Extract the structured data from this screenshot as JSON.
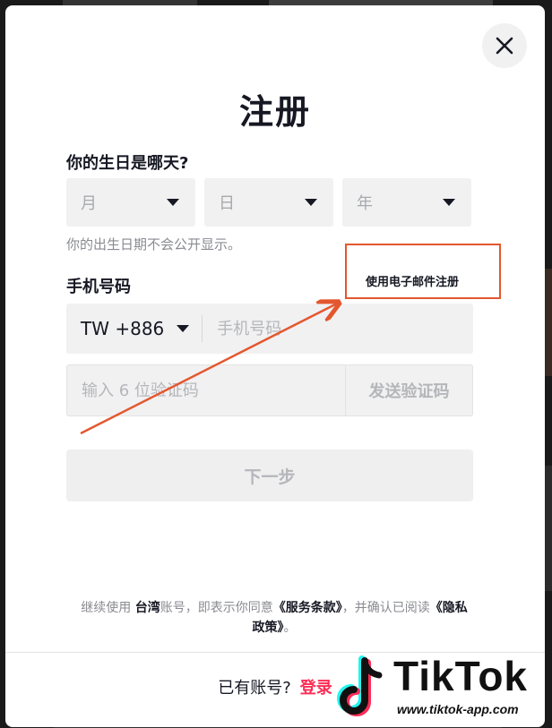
{
  "modal": {
    "title": "注册",
    "birthday": {
      "label": "你的生日是哪天?",
      "month_placeholder": "月",
      "day_placeholder": "日",
      "year_placeholder": "年",
      "hint": "你的出生日期不会公开显示。"
    },
    "phone": {
      "label": "手机号码",
      "email_link": "使用电子邮件注册",
      "country_code": "TW +886",
      "phone_placeholder": "手机号码",
      "code_placeholder": "输入 6 位验证码",
      "send_code_label": "发送验证码"
    },
    "next_label": "下一步",
    "terms": {
      "prefix": "继续使用 ",
      "region": "台湾",
      "middle": "账号，即表示你同意",
      "terms_link": "《服务条款》",
      "middle2": "，并确认已阅读",
      "privacy_link": "《隐私政策》",
      "suffix": "。"
    },
    "footer": {
      "question": "已有账号?",
      "login_label": "登录"
    }
  },
  "watermark": {
    "brand": "TikTok",
    "url": "www.tiktok-app.com"
  },
  "colors": {
    "annotation": "#e4572e",
    "accent": "#fe2c55",
    "field_bg": "#f1f1f2"
  },
  "icons": {
    "close": "close-icon",
    "dropdown": "chevron-down-icon",
    "brand": "tiktok-note-icon"
  }
}
